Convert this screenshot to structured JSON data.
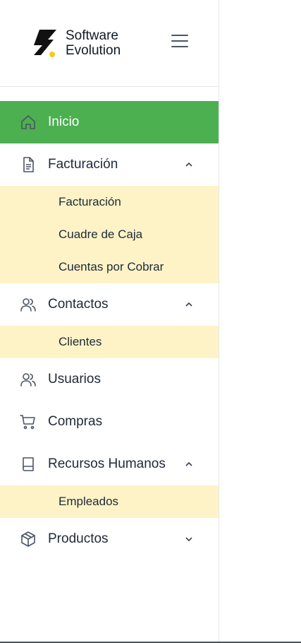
{
  "brand": {
    "line1": "Software",
    "line2": "Evolution",
    "accent_color": "#facc15"
  },
  "menu_button_icon": "hamburger-icon",
  "nav": {
    "active_color": "#4caf50",
    "submenu_color": "#fdf3c7",
    "items": [
      {
        "label": "Inicio",
        "icon": "home-icon",
        "active": true
      },
      {
        "label": "Facturación",
        "icon": "document-icon",
        "expanded": true,
        "children": [
          "Facturación",
          "Cuadre de Caja",
          "Cuentas por Cobrar"
        ]
      },
      {
        "label": "Contactos",
        "icon": "users-icon",
        "expanded": true,
        "children": [
          "Clientes"
        ]
      },
      {
        "label": "Usuarios",
        "icon": "users-icon"
      },
      {
        "label": "Compras",
        "icon": "cart-icon"
      },
      {
        "label": "Recursos Humanos",
        "icon": "book-icon",
        "expanded": true,
        "children": [
          "Empleados"
        ]
      },
      {
        "label": "Productos",
        "icon": "box-icon",
        "expanded": false
      }
    ]
  }
}
